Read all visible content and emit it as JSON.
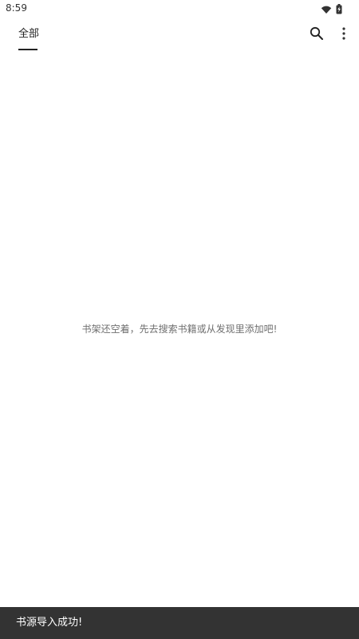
{
  "status_bar": {
    "time": "8:59",
    "icons": [
      "wifi-icon",
      "battery-icon"
    ]
  },
  "app_bar": {
    "tabs": [
      {
        "label": "全部",
        "selected": true
      }
    ],
    "actions": [
      "search-icon",
      "more-vert-icon"
    ]
  },
  "main": {
    "empty_message": "书架还空着，先去搜索书籍或从发现里添加吧!"
  },
  "snackbar": {
    "message": "书源导入成功!"
  },
  "colors": {
    "background": "#ffffff",
    "text": "#222222",
    "muted_text": "#6f6f6f",
    "snackbar_background": "#333333",
    "snackbar_text": "#ffffff"
  }
}
